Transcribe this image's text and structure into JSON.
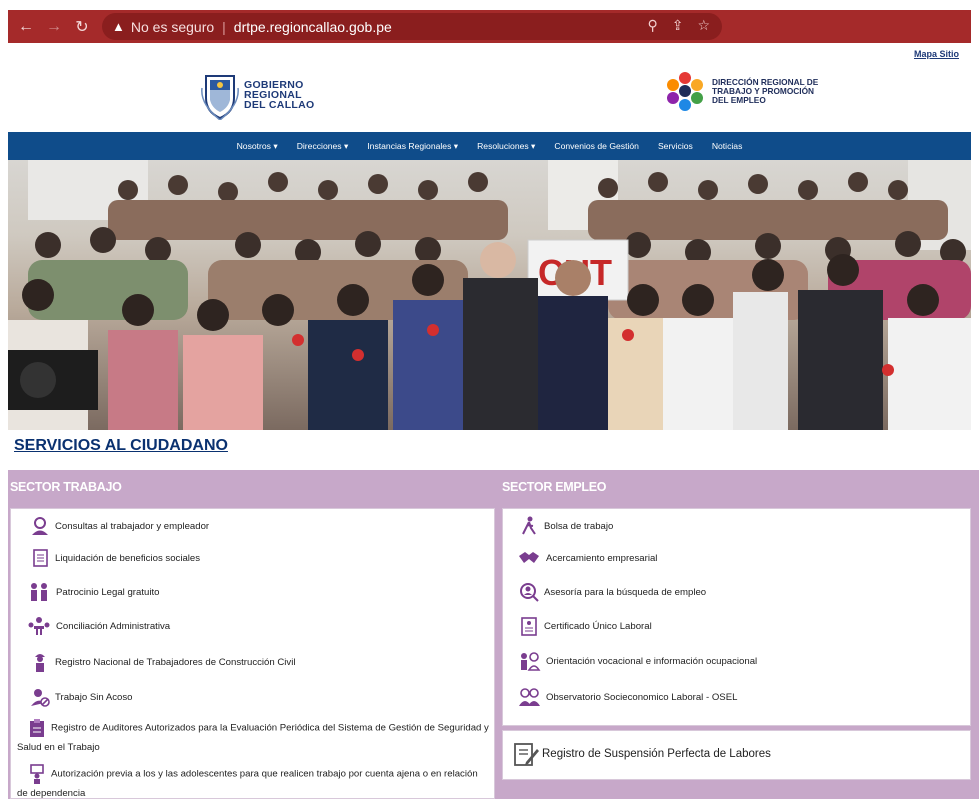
{
  "browser": {
    "security": "No es seguro",
    "url": "drtpe.regioncallao.gob.pe"
  },
  "header": {
    "site_map": "Mapa Sitio",
    "gob_line1": "GOBIERNO",
    "gob_line2": "REGIONAL",
    "gob_line3": "DEL CALLAO",
    "drtpe_line1": "DIRECCIÓN REGIONAL DE",
    "drtpe_line2": "TRABAJO Y PROMOCIÓN",
    "drtpe_line3": "DEL EMPLEO"
  },
  "nav": {
    "items": [
      "Nosotros ▾",
      "Direcciones ▾",
      "Instancias Regionales ▾",
      "Resoluciones ▾",
      "Convenios de Gestión",
      "Servicios",
      "Noticias"
    ]
  },
  "hero": {
    "banner_text": "CUT"
  },
  "services": {
    "title": "SERVICIOS AL CIUDADANO",
    "trabajo": {
      "heading": "SECTOR TRABAJO",
      "items": [
        "Consultas al trabajador y empleador",
        "Liquidación de beneficios sociales",
        "Patrocinio Legal gratuito",
        "Conciliación Administrativa",
        "Registro Nacional de Trabajadores de Construcción Civil",
        "Trabajo Sin Acoso",
        "Registro de Auditores Autorizados para la Evaluación Periódica del Sistema de Gestión de Seguridad y Salud en el Trabajo",
        "Autorización previa a los y las adolescentes para que realicen trabajo por cuenta ajena o en relación de dependencia"
      ]
    },
    "empleo": {
      "heading": "SECTOR EMPLEO",
      "items": [
        "Bolsa de trabajo",
        "Acercamiento empresarial",
        "Asesoría para la búsqueda de empleo",
        "Certificado Único Laboral",
        "Orientación vocacional e información ocupacional",
        "Observatorio Socieconomico Laboral - OSEL"
      ],
      "suspension": "Registro de Suspensión Perfecta de Labores"
    }
  },
  "colors": {
    "browser_bar": "#a52a2a",
    "nav_bar": "#0f4c8a",
    "panel": "#c7a8c9",
    "icon_purple": "#7a3d8f"
  }
}
